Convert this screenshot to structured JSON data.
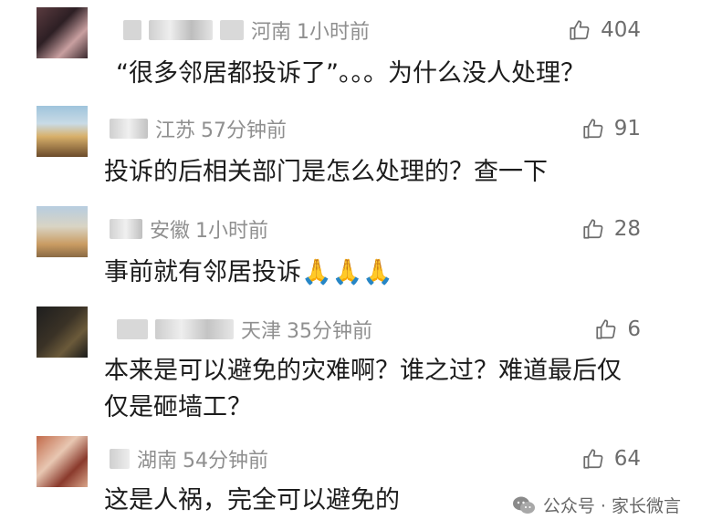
{
  "comments": [
    {
      "location": "河南",
      "time": "1小时前",
      "likes": "404",
      "text": "“很多邻居都投诉了”。。。为什么没人处理？"
    },
    {
      "location": "江苏",
      "time": "57分钟前",
      "likes": "91",
      "text": "投诉的后相关部门是怎么处理的？查一下"
    },
    {
      "location": "安徽",
      "time": "1小时前",
      "likes": "28",
      "text": "事前就有邻居投诉🙏🙏🙏"
    },
    {
      "location": "天津",
      "time": "35分钟前",
      "likes": "6",
      "text_line1": "本来是可以避免的灾难啊？谁之过？难道最后仅",
      "text_line2": "仅是砸墙工？"
    },
    {
      "location": "湖南",
      "time": "54分钟前",
      "likes": "64",
      "text": "这是人祸，完全可以避免的"
    }
  ],
  "watermark": {
    "label": "公众号 · 家长微言"
  },
  "icons": {
    "like": "thumbs-up-icon",
    "watermark": "wechat-icon"
  },
  "colors": {
    "meta_text": "#8f8f8f",
    "body_text": "#1c1c1c",
    "likes_text": "#6d6d6d"
  }
}
